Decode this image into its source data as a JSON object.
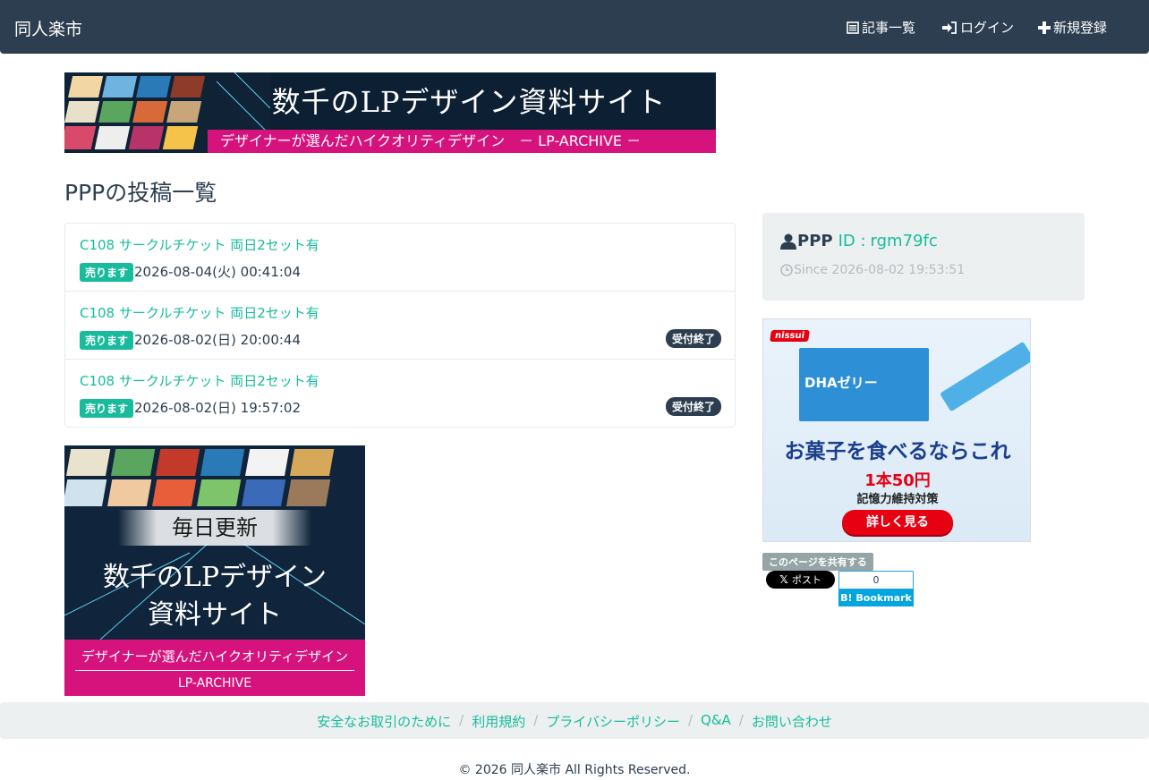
{
  "navbar": {
    "brand": "同人楽市",
    "items": [
      {
        "label": "記事一覧",
        "icon": "list-alt-icon"
      },
      {
        "label": "ログイン",
        "icon": "log-in-icon"
      },
      {
        "label": "新規登録",
        "icon": "plus-icon"
      }
    ]
  },
  "banner_top": {
    "headline": "数千のLPデザイン資料サイト",
    "tagline": "デザイナーが選んだハイクオリティデザイン　－ LP-ARCHIVE －"
  },
  "page_title": "PPPの投稿一覧",
  "posts": [
    {
      "title": "C108 サークルチケット 両日2セット有",
      "badge": "売ります",
      "date": "2026-08-04(火) 00:41:04",
      "status": ""
    },
    {
      "title": "C108 サークルチケット 両日2セット有",
      "badge": "売ります",
      "date": "2026-08-02(日) 20:00:44",
      "status": "受付終了"
    },
    {
      "title": "C108 サークルチケット 両日2セット有",
      "badge": "売ります",
      "date": "2026-08-02(日) 19:57:02",
      "status": "受付終了"
    }
  ],
  "banner_square": {
    "daily": "毎日更新",
    "line1": "数千のLPデザイン",
    "line2": "資料サイト",
    "tagline": "デザイナーが選んだハイクオリティデザイン",
    "brand": "LP-ARCHIVE"
  },
  "profile": {
    "username": "PPP",
    "id_label": "ID :",
    "id": "rgm79fc",
    "since": "Since 2026-08-02 19:53:51"
  },
  "ad": {
    "logo": "nissui",
    "product": "DHAゼリー",
    "copy1": "お菓子を食べるならこれ",
    "copy2": "1本50円",
    "copy3": "記憶力維持対策",
    "cta": "詳しく見る"
  },
  "share": {
    "label": "このページを共有する",
    "post_label": "ポスト",
    "bookmark_count": "0",
    "bookmark_label": "Bookmark"
  },
  "footer": {
    "links": [
      "安全なお取引のために",
      "利用規約",
      "プライバシーポリシー",
      "Q&A",
      "お問い合わせ"
    ],
    "copyright": "© 2026 同人楽市 All Rights Reserved."
  },
  "colors": {
    "navbar": "#2c3e50",
    "accent": "#18bc9c",
    "panel": "#ecf0f1",
    "banner_pink": "#d6127d"
  }
}
